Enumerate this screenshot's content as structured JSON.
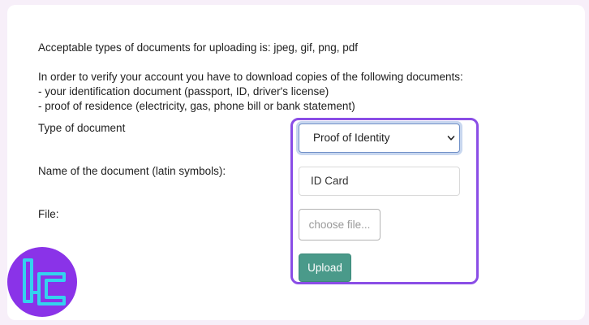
{
  "instructions": {
    "acceptable_types": "Acceptable types of documents for uploading is: jpeg, gif, png, pdf",
    "verify_intro": "In order to verify your account you have to download copies of the following documents:",
    "bullet_identification": "- your identification document (passport, ID, driver's license)",
    "bullet_residence": "- proof of residence (electricity, gas, phone bill or bank statement)"
  },
  "form": {
    "type_label": "Type of document",
    "type_value": "Proof of Identity",
    "name_label": "Name of the document (latin symbols):",
    "name_value": "ID Card",
    "file_label": "File:",
    "file_button": "choose file...",
    "upload_button": "Upload"
  },
  "colors": {
    "highlight_border": "#8a4de6",
    "upload_bg": "#4a9a8a",
    "logo_bg": "#8a33e8",
    "logo_stroke": "#34d2ee"
  },
  "icons": {
    "select_caret": "chevron-down-icon",
    "brand_logo": "tc-logo-icon"
  }
}
